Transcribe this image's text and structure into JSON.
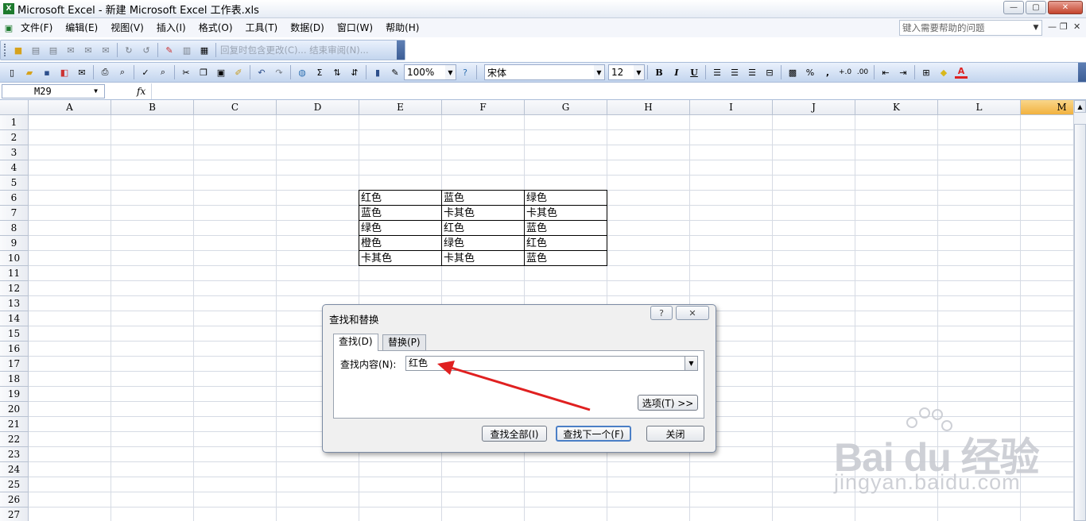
{
  "window": {
    "title": "Microsoft Excel - 新建 Microsoft Excel 工作表.xls",
    "icon_label": "X"
  },
  "menu": [
    "文件(F)",
    "编辑(E)",
    "视图(V)",
    "插入(I)",
    "格式(O)",
    "工具(T)",
    "数据(D)",
    "窗口(W)",
    "帮助(H)"
  ],
  "help_placeholder": "键入需要帮助的问题",
  "review_toolbar_text": "回复时包含更改(C)...  结束审阅(N)...",
  "standard_toolbar": {
    "zoom": "100%",
    "font": "宋体",
    "font_size": "12",
    "bold": "B",
    "italic": "I",
    "underline": "U",
    "percent": "%",
    "comma": ",",
    "font_color_icon": "A"
  },
  "formula_bar": {
    "name_box": "M29",
    "fx": "fx",
    "content": ""
  },
  "columns": [
    "A",
    "B",
    "C",
    "D",
    "E",
    "F",
    "G",
    "H",
    "I",
    "J",
    "K",
    "L",
    "M"
  ],
  "selected_column": "M",
  "rows": [
    "1",
    "2",
    "3",
    "4",
    "5",
    "6",
    "7",
    "8",
    "9",
    "10",
    "11",
    "12",
    "13",
    "14",
    "15",
    "16",
    "17",
    "18",
    "19",
    "20",
    "21",
    "22",
    "23",
    "24",
    "25",
    "26",
    "27"
  ],
  "cells": {
    "E6": "红色",
    "F6": "蓝色",
    "G6": "绿色",
    "E7": "蓝色",
    "F7": "卡其色",
    "G7": "卡其色",
    "E8": "绿色",
    "F8": "红色",
    "G8": "蓝色",
    "E9": "橙色",
    "F9": "绿色",
    "G9": "红色",
    "E10": "卡其色",
    "F10": "卡其色",
    "G10": "蓝色"
  },
  "dialog": {
    "title": "查找和替换",
    "help_btn": "?",
    "close_btn": "✕",
    "tab_find": "查找(D)",
    "tab_replace": "替换(P)",
    "find_label": "查找内容(N):",
    "find_value": "红色",
    "options_btn": "选项(T) >>",
    "find_all_btn": "查找全部(I)",
    "find_next_btn": "查找下一个(F)",
    "close_action_btn": "关闭"
  },
  "watermark": {
    "brand": "Bai du 经验",
    "url": "jingyan.baidu.com"
  }
}
